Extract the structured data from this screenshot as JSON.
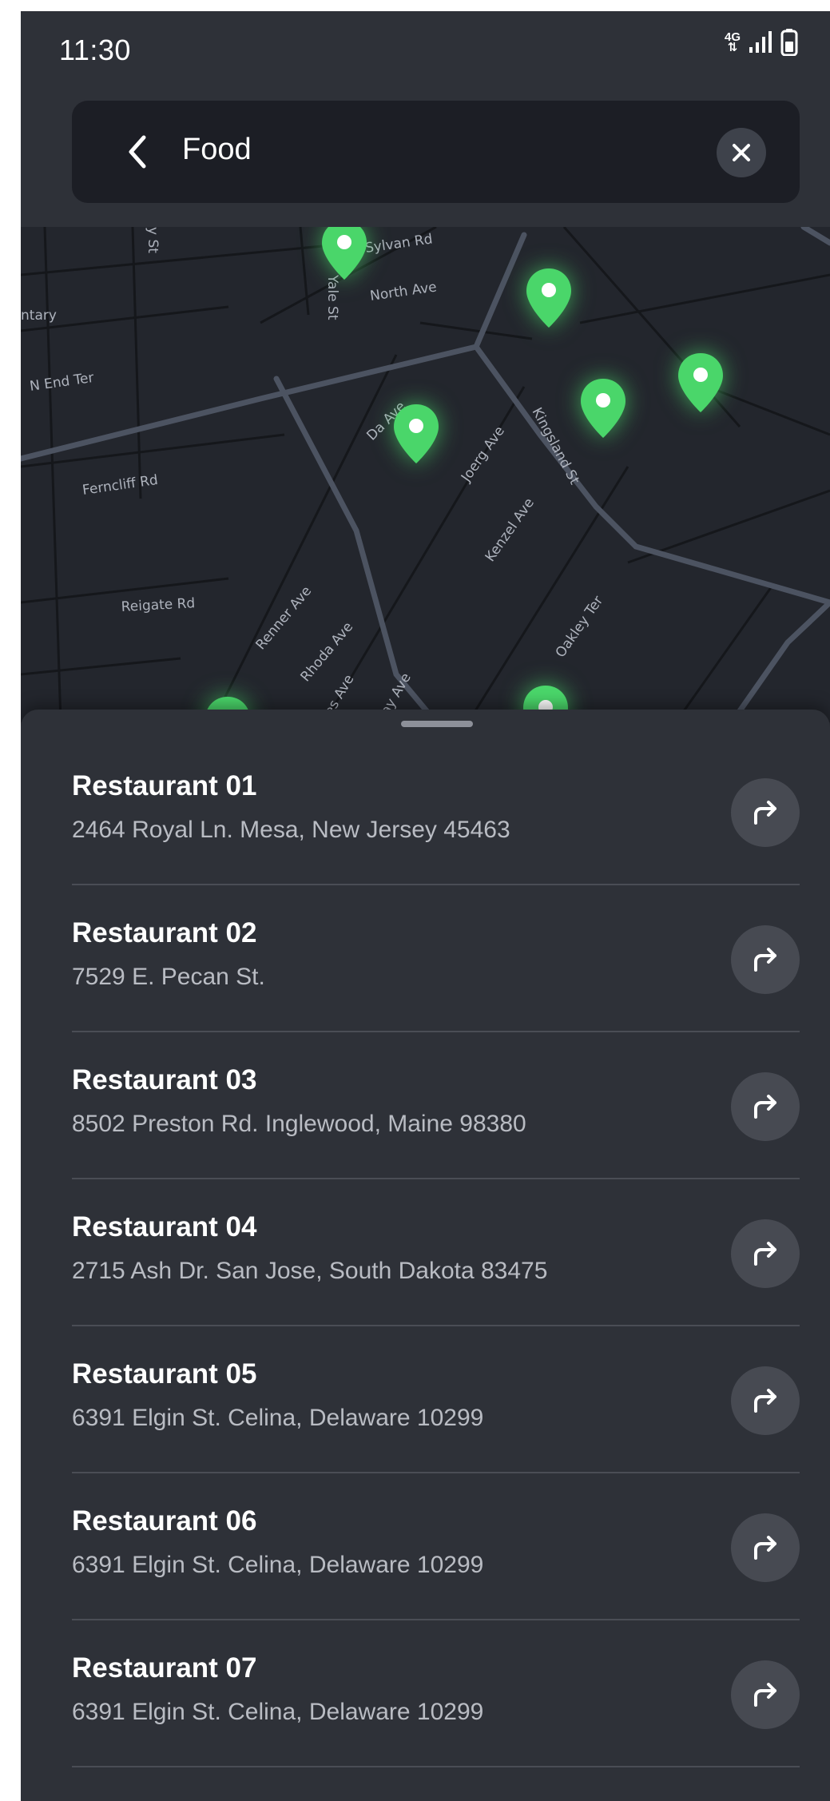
{
  "status_bar": {
    "time": "11:30",
    "network_top": "4G",
    "network_bottom": "⇅"
  },
  "search": {
    "value": "Food",
    "back_icon": "chevron-left-icon",
    "clear_icon": "close-icon"
  },
  "map": {
    "street_labels": [
      "Sylvan Rd",
      "North Ave",
      "Yale St",
      "N End Ter",
      "ntary",
      "y St",
      "Ferncliff Rd",
      "Reigate Rd",
      "Renner Ave",
      "Rhoda Ave",
      "Joerg Ave",
      "Kenzel Ave",
      "Kingsland St",
      "Oakley Ter",
      "Da Ave",
      "oes Ave",
      "ay Ave"
    ],
    "pin_color": "#4ad66a"
  },
  "restaurants": [
    {
      "name": "Restaurant 01",
      "address": "2464 Royal Ln. Mesa, New Jersey 45463"
    },
    {
      "name": "Restaurant 02",
      "address": "7529 E. Pecan St."
    },
    {
      "name": "Restaurant 03",
      "address": "8502 Preston Rd. Inglewood, Maine 98380"
    },
    {
      "name": "Restaurant 04",
      "address": "2715 Ash Dr. San Jose, South Dakota 83475"
    },
    {
      "name": "Restaurant 05",
      "address": "6391 Elgin St. Celina, Delaware 10299"
    },
    {
      "name": "Restaurant 06",
      "address": "6391 Elgin St. Celina, Delaware 10299"
    },
    {
      "name": "Restaurant 07",
      "address": "6391 Elgin St. Celina, Delaware 10299"
    }
  ],
  "icons": {
    "directions": "directions-arrow-icon"
  }
}
